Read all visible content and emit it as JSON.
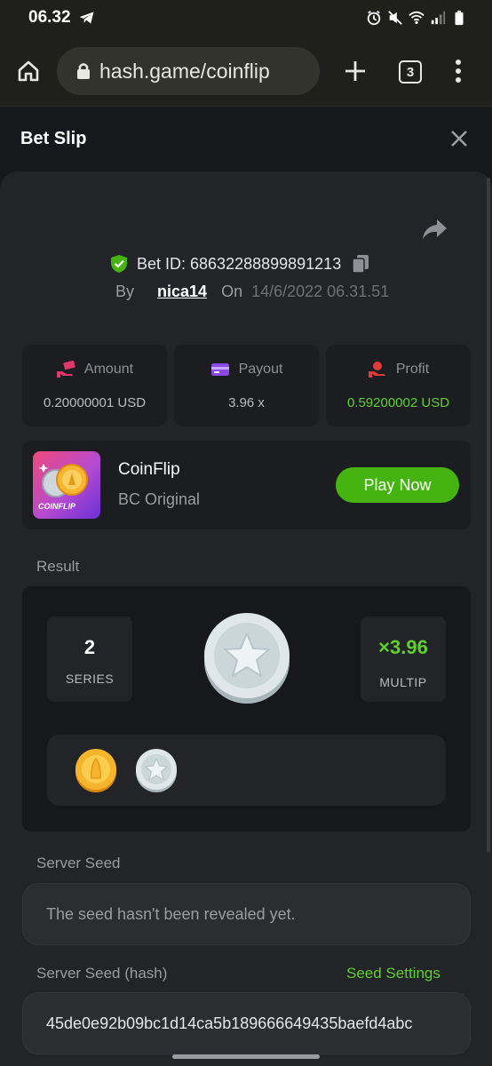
{
  "status_bar": {
    "time": "06.32"
  },
  "browser": {
    "url": "hash.game/coinflip",
    "tab_count": "3"
  },
  "slip": {
    "title": "Bet Slip"
  },
  "bet": {
    "id_text": "Bet ID: 68632288899891213",
    "by_label": "By",
    "user": "nica14",
    "on_label": "On",
    "date": "14/6/2022 06.31.51"
  },
  "stats": [
    {
      "label": "Amount",
      "value": "0.20000001 USD",
      "icon": "money-hand-icon",
      "color": "#e0386b"
    },
    {
      "label": "Payout",
      "value": "3.96 x",
      "icon": "card-icon",
      "color": "#8a49e6"
    },
    {
      "label": "Profit",
      "value": "0.59200002 USD",
      "icon": "profit-hand-icon",
      "color": "#e03a3a"
    }
  ],
  "game": {
    "name": "CoinFlip",
    "subtitle": "BC Original",
    "play_label": "Play Now",
    "thumb_text": "COINFLIP"
  },
  "result": {
    "label": "Result",
    "series_value": "2",
    "series_label": "SERIES",
    "multiplier": "×3.96",
    "multiplier_label": "MULTIP",
    "history": [
      "gold",
      "silver"
    ]
  },
  "server_seed": {
    "label": "Server Seed",
    "value": "The seed hasn't been revealed yet."
  },
  "server_seed_hash": {
    "label": "Server Seed (hash)",
    "settings_label": "Seed Settings",
    "value": "45de0e92b09bc1d14ca5b189666649435baefd4abc"
  },
  "colors": {
    "accent_green": "#5fd02d",
    "button_green": "#45b410",
    "panel": "#232427"
  }
}
